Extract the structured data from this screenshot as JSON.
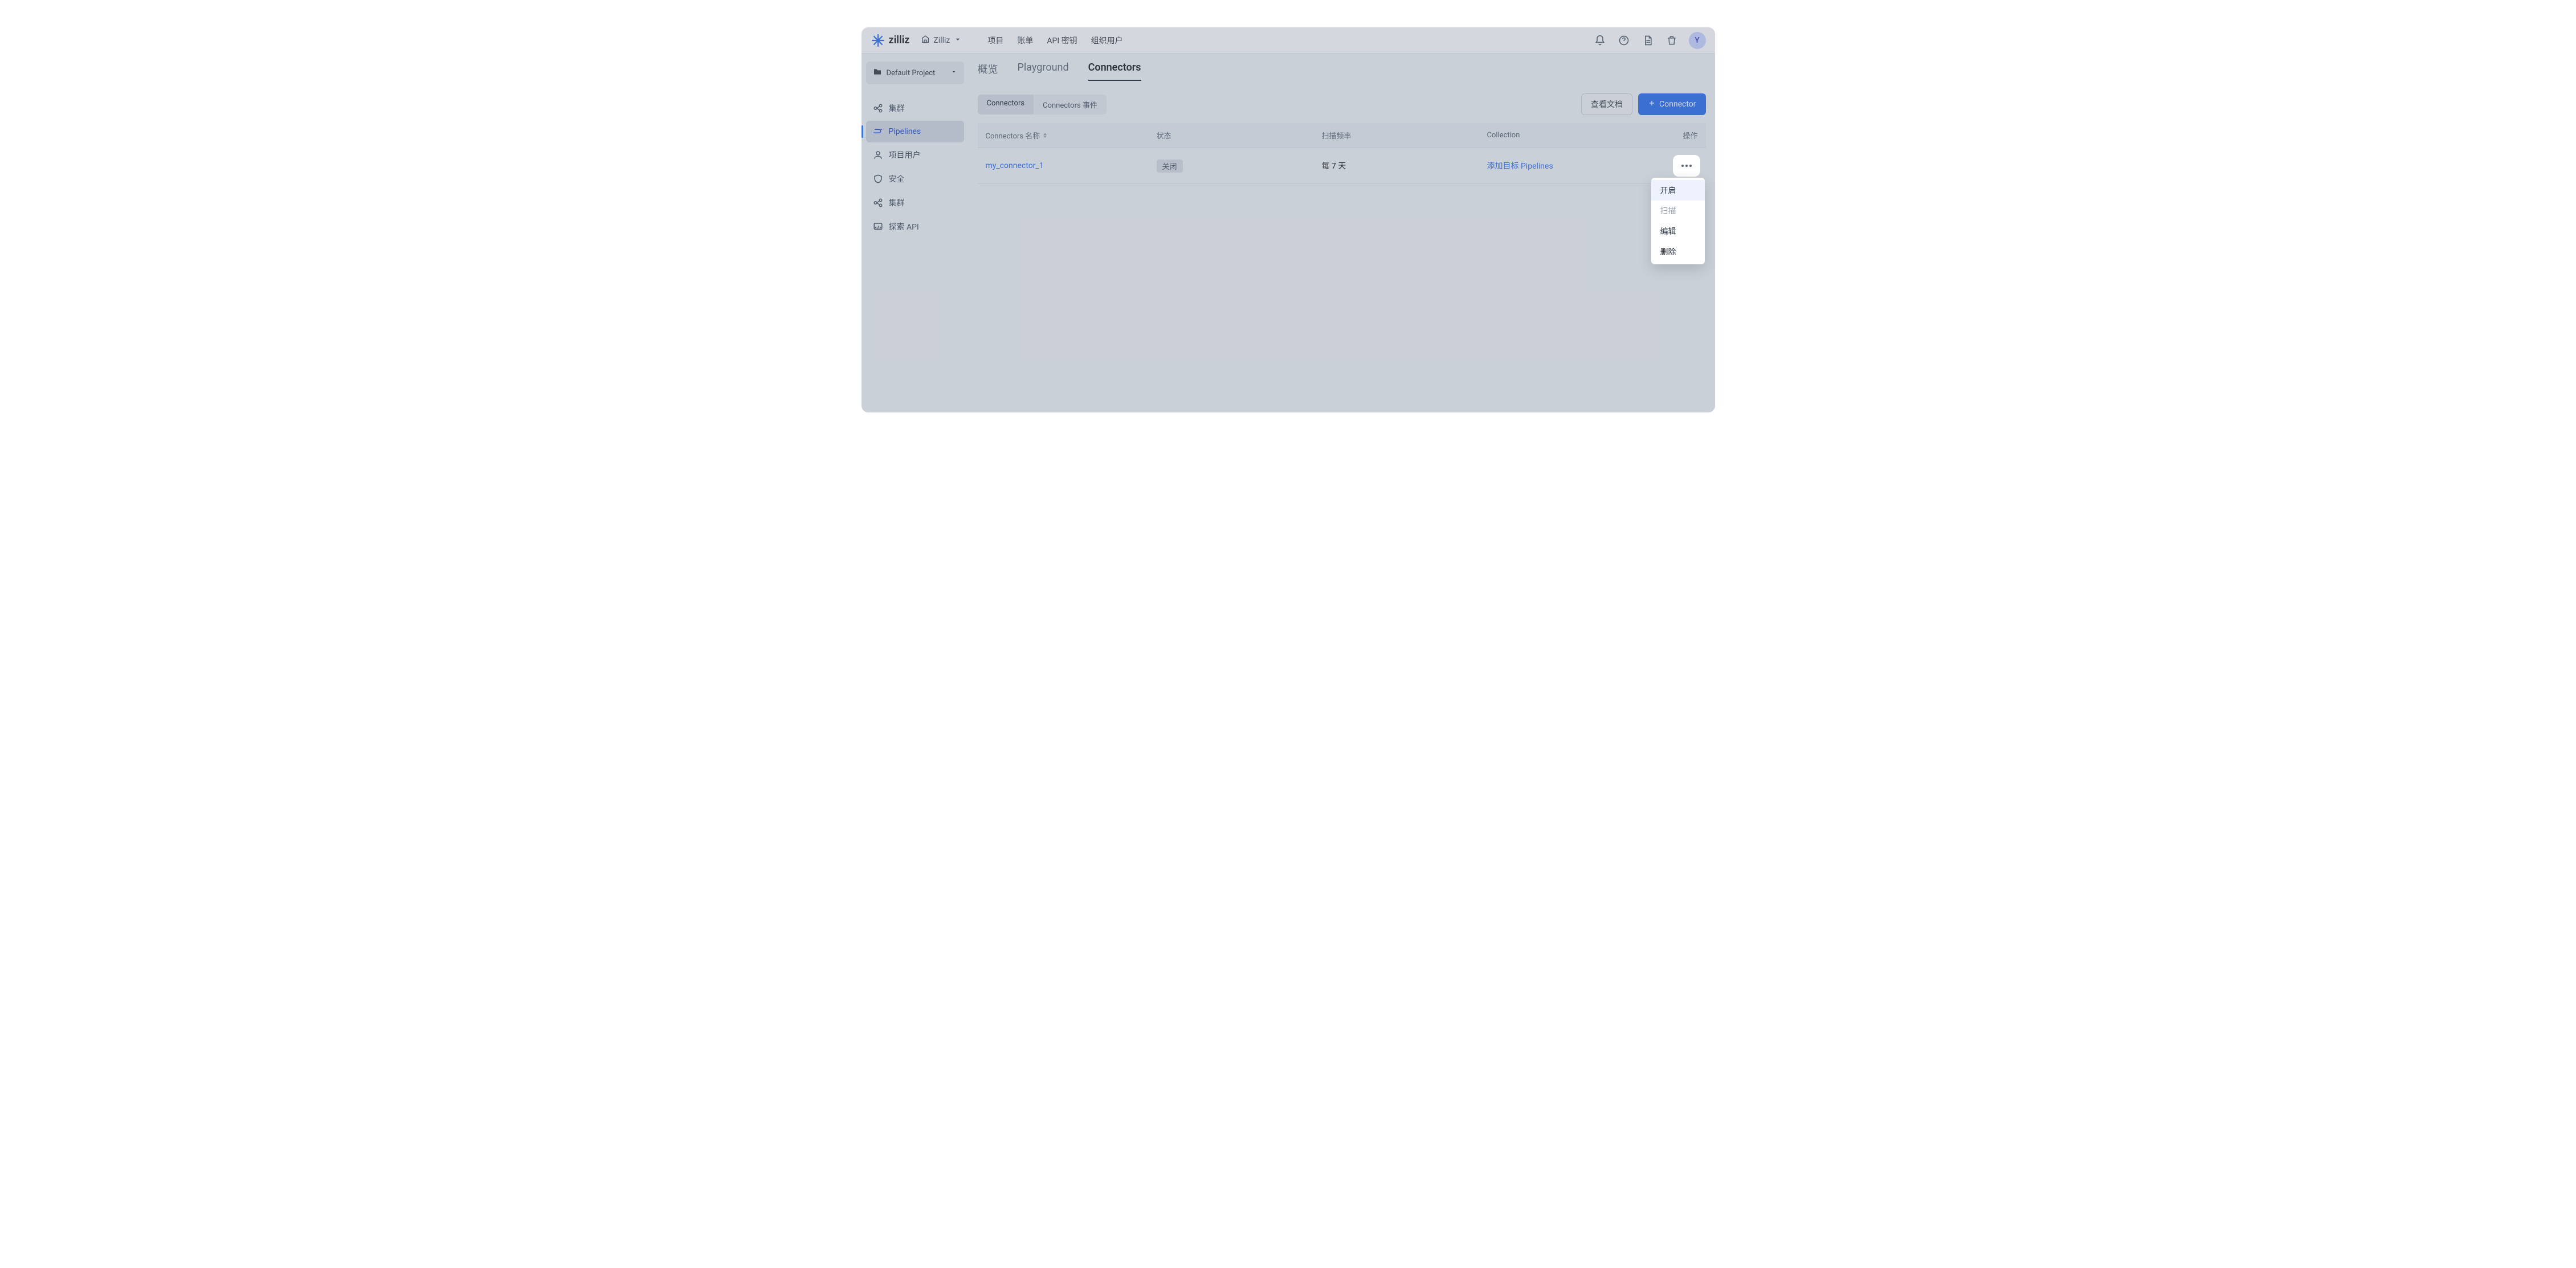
{
  "brand": "zilliz",
  "org_name": "Zilliz",
  "avatar_initial": "Y",
  "topnav": {
    "items": [
      "项目",
      "账单",
      "API 密钥",
      "组织用户"
    ]
  },
  "sidebar": {
    "project_label": "Default Project",
    "items": [
      {
        "label": "集群"
      },
      {
        "label": "Pipelines"
      },
      {
        "label": "项目用户"
      },
      {
        "label": "安全"
      },
      {
        "label": "集群"
      },
      {
        "label": "探索 API"
      }
    ],
    "active_index": 1
  },
  "main": {
    "tabs": [
      "概览",
      "Playground",
      "Connectors"
    ],
    "active_tab": 2,
    "subtabs": [
      "Connectors",
      "Connectors 事件"
    ],
    "active_subtab": 0,
    "view_docs_label": "查看文档",
    "add_btn_label": "Connector"
  },
  "table": {
    "columns": [
      "Connectors 名称",
      "状态",
      "扫描频率",
      "Collection",
      "操作"
    ],
    "rows": [
      {
        "name": "my_connector_1",
        "status": "关闭",
        "scan": "每 7 天",
        "collection": "添加目标 Pipelines"
      }
    ]
  },
  "dropdown": {
    "items": [
      {
        "label": "开启",
        "state": "highlight"
      },
      {
        "label": "扫描",
        "state": "disabled"
      },
      {
        "label": "编辑",
        "state": "normal"
      },
      {
        "label": "删除",
        "state": "normal"
      }
    ]
  }
}
